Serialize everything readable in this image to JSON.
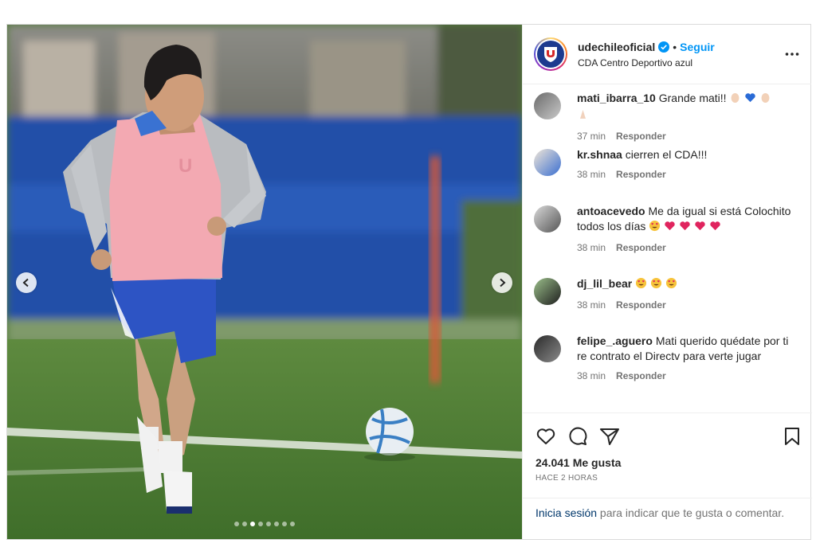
{
  "post": {
    "username": "udechileoficial",
    "follow_separator": "•",
    "follow_label": "Seguir",
    "location": "CDA Centro Deportivo azul",
    "carousel": {
      "slide_count": 8,
      "active_index": 2
    }
  },
  "comments": [
    {
      "user": "mati_ibarra_10",
      "text": "Grande mati!!",
      "emojis": [
        "hand-light",
        "blue-heart",
        "hand-light"
      ],
      "emojis_line2": [
        "praying-hands"
      ],
      "time": "37 min",
      "reply": "Responder"
    },
    {
      "user": "kr.shnaa",
      "text": "cierren el CDA!!!",
      "time": "38 min",
      "reply": "Responder"
    },
    {
      "user": "antoacevedo",
      "text": "Me da igual si está Colochito todos los días",
      "emojis": [
        "heart-eyes",
        "red-heart",
        "red-heart",
        "red-heart",
        "red-heart"
      ],
      "time": "38 min",
      "reply": "Responder"
    },
    {
      "user": "dj_lil_bear",
      "text": "",
      "emojis": [
        "heart-eyes",
        "heart-eyes",
        "heart-eyes"
      ],
      "time": "38 min",
      "reply": "Responder"
    },
    {
      "user": "felipe_.aguero",
      "text": "Mati querido quédate por ti re contrato el Directv para verte jugar",
      "time": "38 min",
      "reply": "Responder"
    }
  ],
  "footer": {
    "likes": "24.041 Me gusta",
    "time_ago": "HACE 2 HORAS",
    "login_link": "Inicia sesión",
    "login_rest": " para indicar que te gusta o comentar."
  },
  "colors": {
    "follow": "#0095f6",
    "verified": "#0095f6",
    "club_blue": "#1d3a8f",
    "club_red": "#d62828"
  }
}
